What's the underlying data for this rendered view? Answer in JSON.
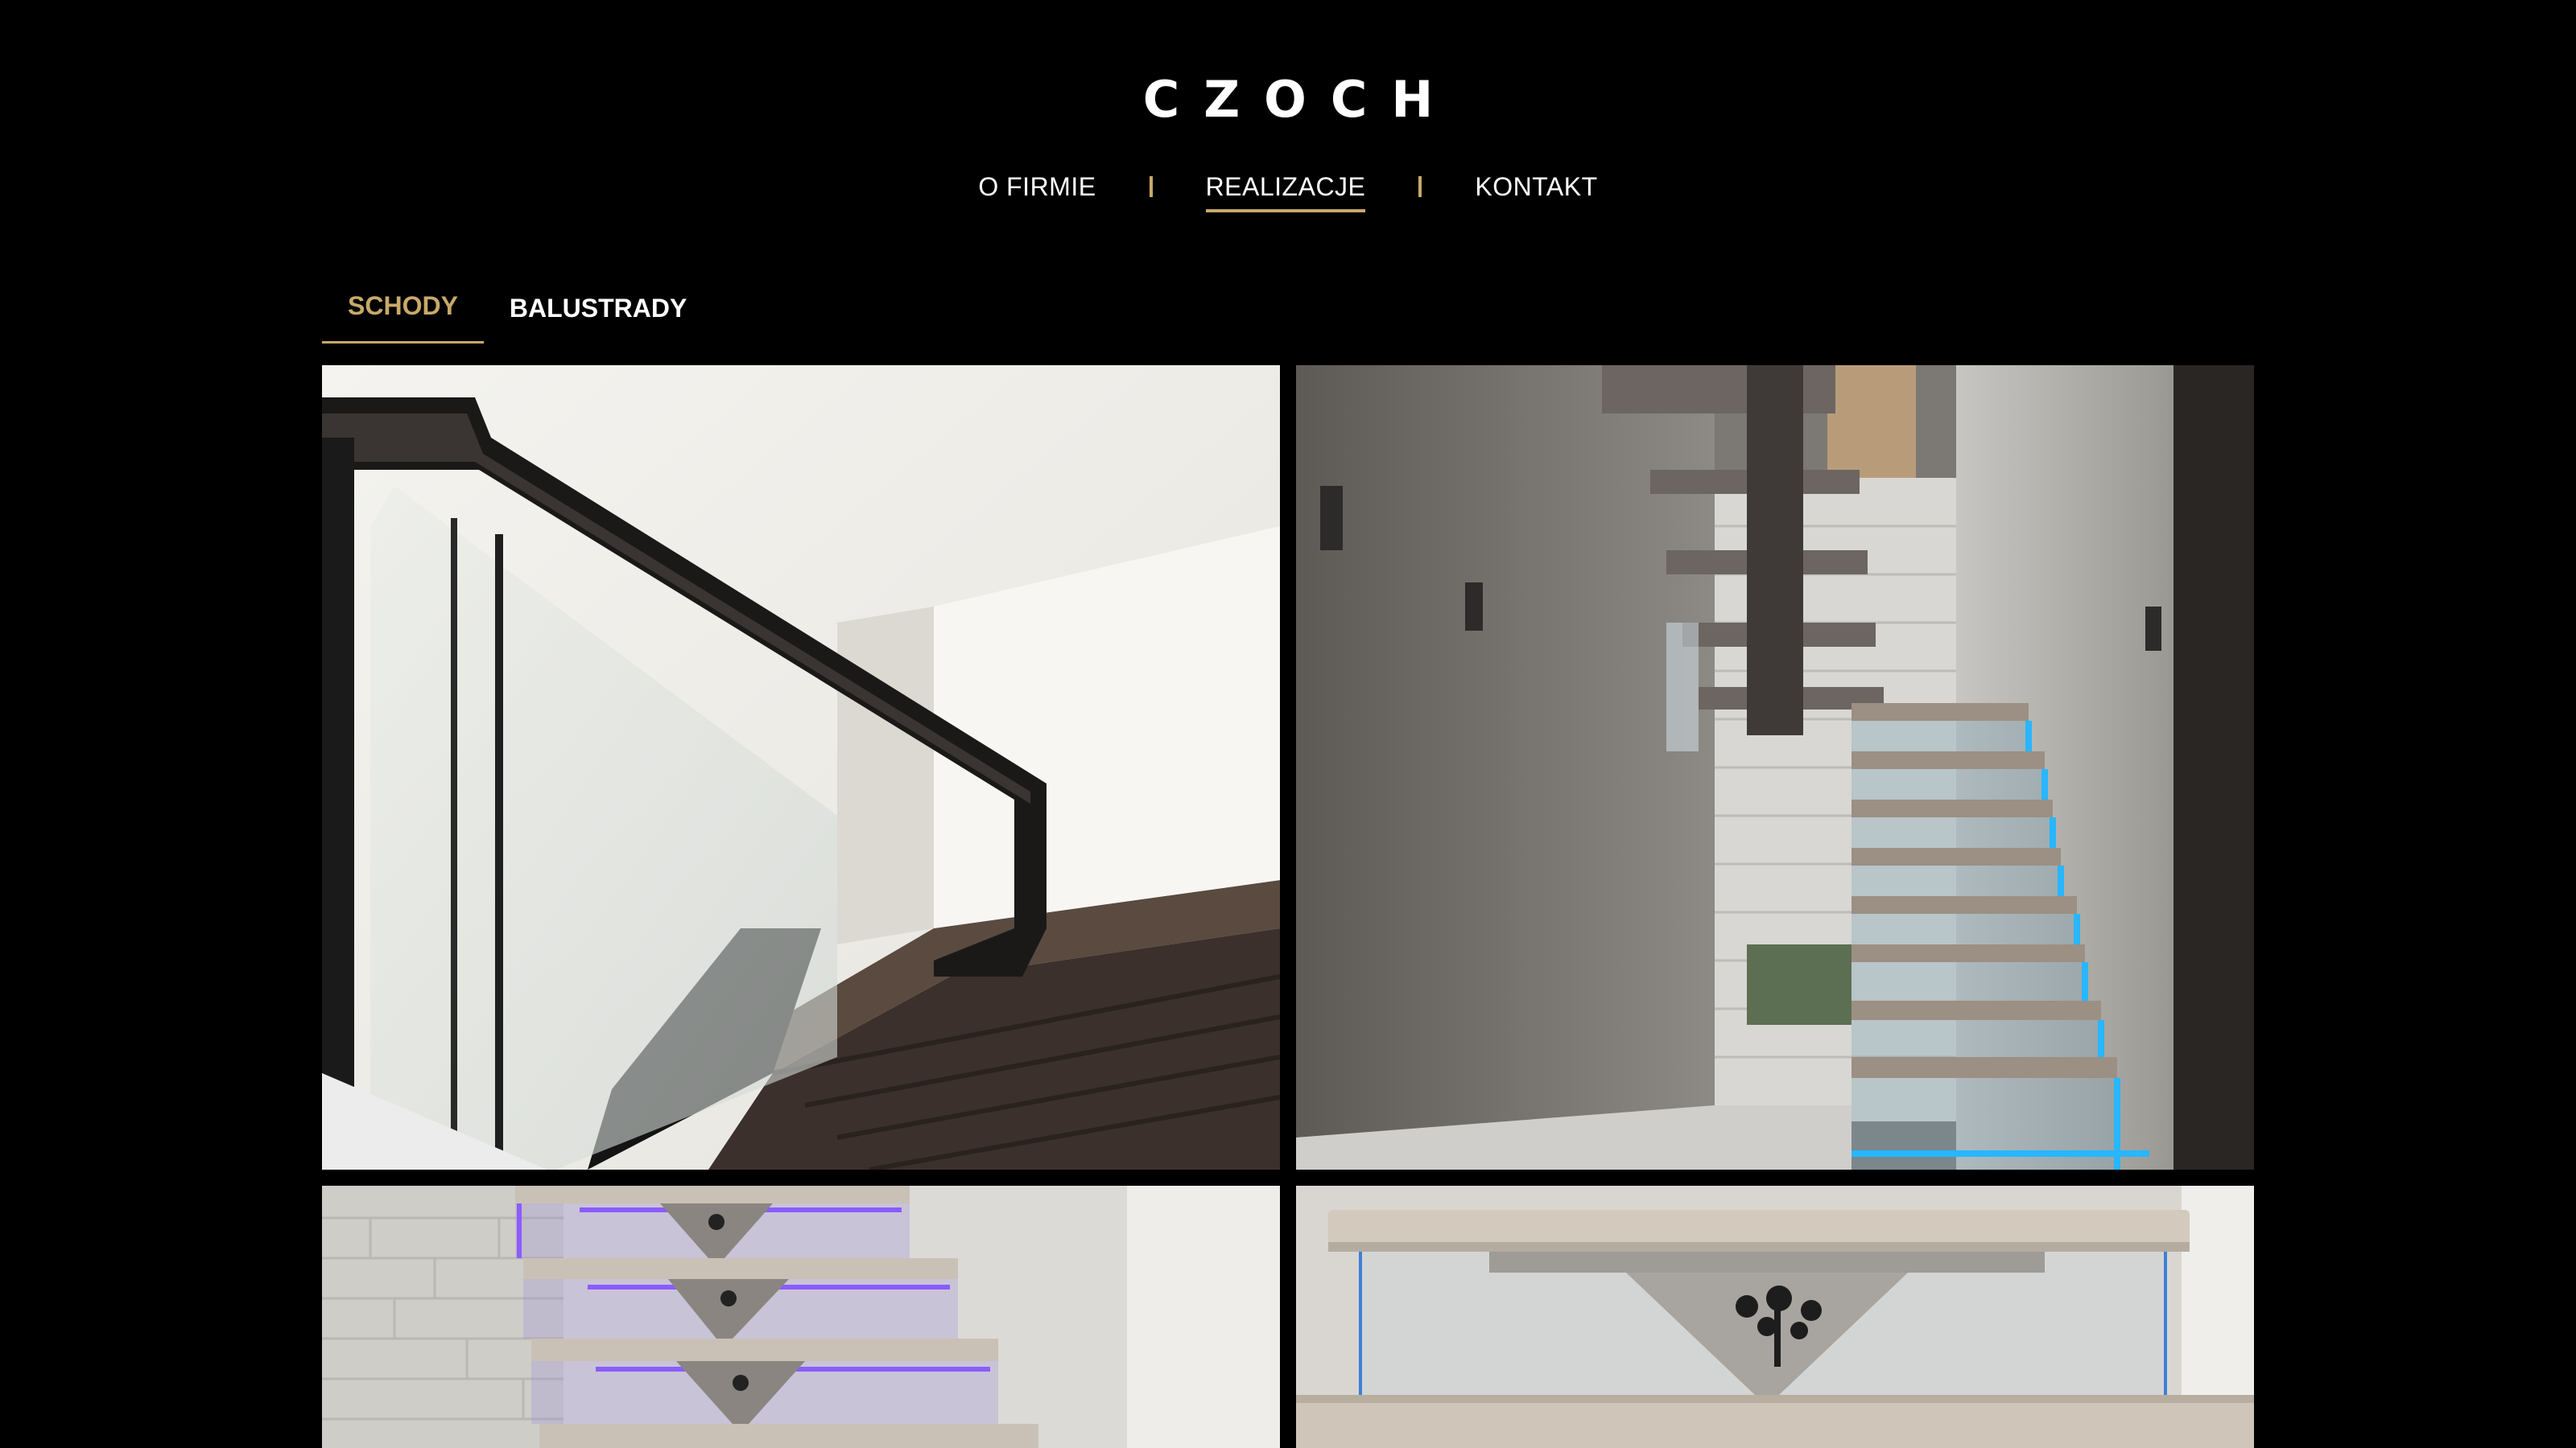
{
  "brand": {
    "logo_text": "CZOCH"
  },
  "nav": {
    "items": [
      {
        "label": "O FIRMIE",
        "active": false
      },
      {
        "label": "REALIZACJE",
        "active": true
      },
      {
        "label": "KONTAKT",
        "active": false
      }
    ]
  },
  "tabs": {
    "items": [
      {
        "label": "SCHODY",
        "active": true
      },
      {
        "label": "BALUSTRADY",
        "active": false
      }
    ]
  },
  "gallery": {
    "photos": [
      {
        "name": "stair-railing-glass-photo"
      },
      {
        "name": "floating-stairs-blue-led-photo"
      },
      {
        "name": "stairs-purple-led-photo"
      },
      {
        "name": "stair-step-tree-motif-photo"
      }
    ]
  },
  "colors": {
    "background": "#000000",
    "accent": "#c8a96a",
    "text": "#ffffff"
  }
}
